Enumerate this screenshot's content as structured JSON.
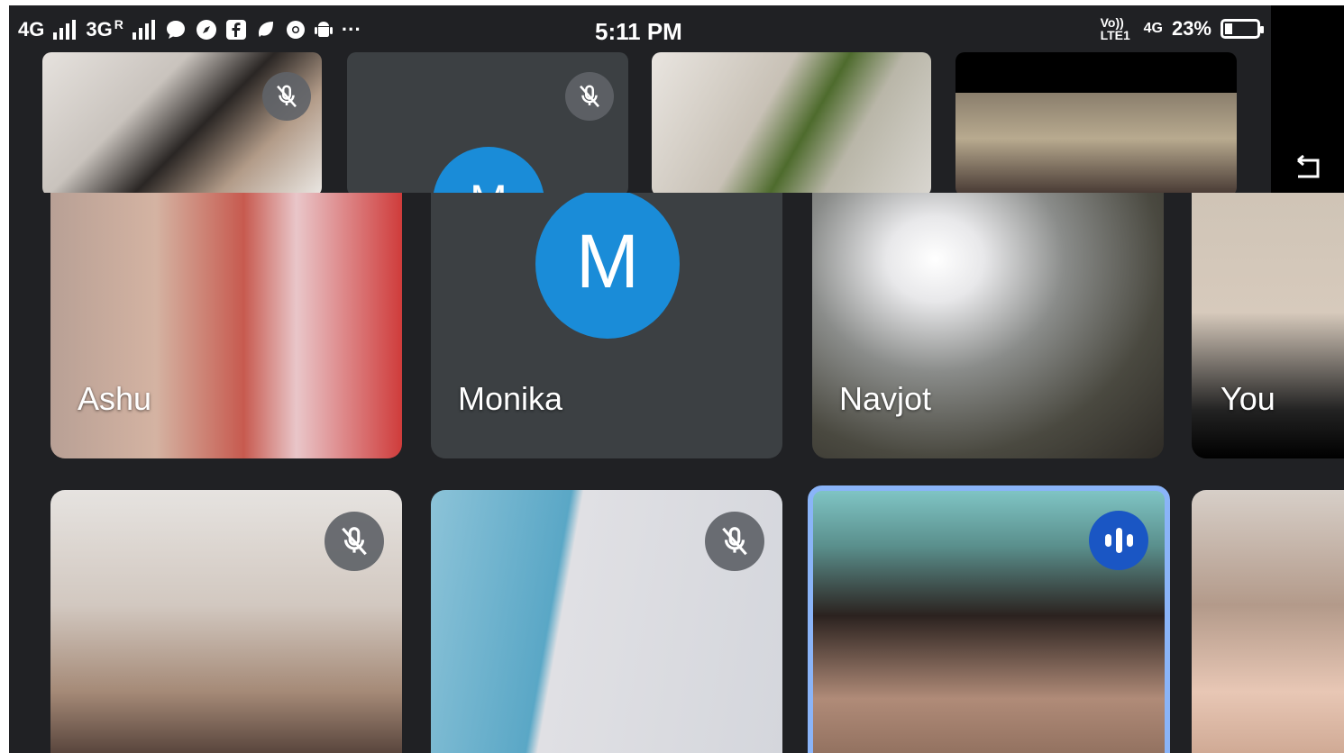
{
  "status_bar": {
    "left_network_1": "4G",
    "left_network_2": "3G",
    "roaming": "R",
    "overflow": "···",
    "time": "5:11 PM",
    "volte": "Vo)) LTE1",
    "right_network": "4G",
    "battery_percent": "23%"
  },
  "top_tiles": [
    {
      "muted": true
    },
    {
      "avatar_letter": "M",
      "muted": true
    },
    {
      "muted": false
    },
    {
      "muted": false
    }
  ],
  "participants": [
    {
      "name": "Ashu"
    },
    {
      "name": "Monika",
      "avatar_letter": "M"
    },
    {
      "name": "Navjot"
    },
    {
      "name": "You"
    }
  ],
  "row2": [
    {
      "muted": true
    },
    {
      "muted": true
    },
    {
      "speaking": true
    },
    {
      "muted": false
    }
  ],
  "colors": {
    "background": "#202124",
    "tile_gray": "#3c4043",
    "avatar_blue": "#1a8cd8",
    "speaking_border": "#8ab4f8",
    "speaking_badge": "#1a56c4"
  }
}
